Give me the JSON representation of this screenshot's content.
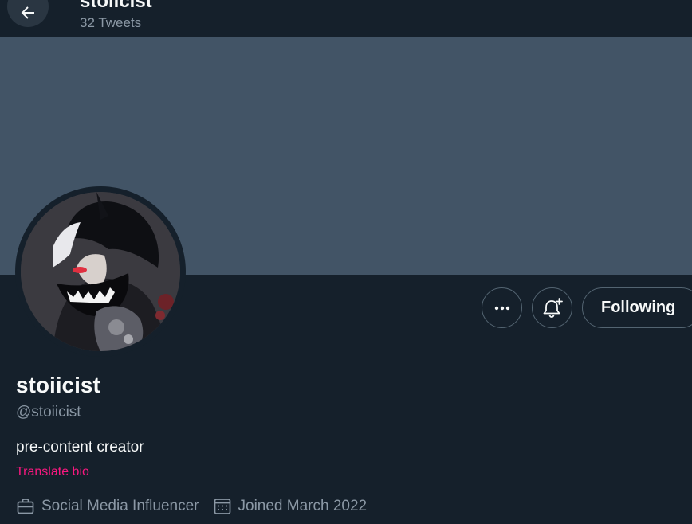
{
  "header": {
    "title": "stoiicist",
    "tweet_count": "32 Tweets",
    "back_icon": "arrow-left-icon"
  },
  "profile": {
    "display_name": "stoiicist",
    "handle": "@stoiicist",
    "bio": "pre-content creator",
    "translate_label": "Translate bio",
    "professional_category": "Social Media Influencer",
    "joined": "Joined March 2022"
  },
  "actions": {
    "more_icon": "more-horizontal-icon",
    "notify_icon": "bell-plus-icon",
    "follow_label": "Following"
  },
  "colors": {
    "background": "#15202b",
    "banner": "#425466",
    "accent_pink": "#f91880",
    "secondary_text": "#8b98a5"
  }
}
